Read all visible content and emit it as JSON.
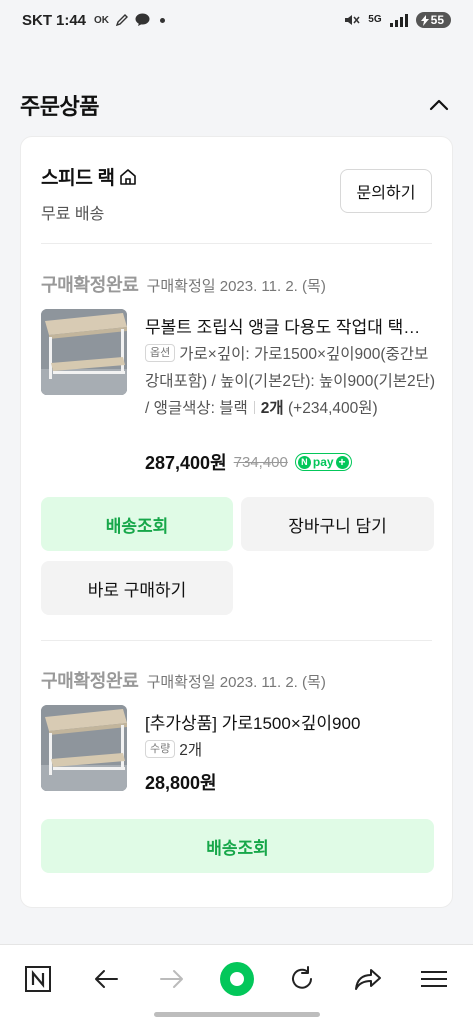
{
  "status_bar": {
    "carrier": "SKT",
    "time": "1:44",
    "network": "5G",
    "battery": "55"
  },
  "section": {
    "title": "주문상품"
  },
  "store": {
    "name": "스피드 랙",
    "shipping": "무료 배송",
    "inquiry_label": "문의하기"
  },
  "orders": [
    {
      "status": "구매확정완료",
      "date": "구매확정일 2023. 11. 2. (목)",
      "product_name": "무볼트 조립식 앵글 다용도 작업대 택배 선반",
      "option_tag": "옵션",
      "option_text": "가로×깊이: 가로1500×깊이900(중간보강대포함) / 높이(기본2단): 높이900(기본2단) / 앵글색상: 블랙",
      "quantity": "2개",
      "extra": "(+234,400원)",
      "price": "287,400원",
      "original_price": "734,400",
      "npay_label": "pay",
      "buttons": {
        "track": "배송조회",
        "cart": "장바구니 담기",
        "buy_now": "바로 구매하기"
      }
    },
    {
      "status": "구매확정완료",
      "date": "구매확정일 2023. 11. 2. (목)",
      "product_name": "[추가상품] 가로1500×깊이900",
      "qty_tag": "수량",
      "quantity": "2개",
      "price": "28,800원",
      "buttons": {
        "track": "배송조회"
      }
    }
  ],
  "bottom_nav": {
    "items": [
      "naver-home",
      "back",
      "forward",
      "green-dot",
      "refresh",
      "share",
      "menu"
    ]
  },
  "colors": {
    "accent_green": "#03c75a",
    "button_green_bg": "#e0fbe6",
    "button_green_text": "#17a74a"
  }
}
